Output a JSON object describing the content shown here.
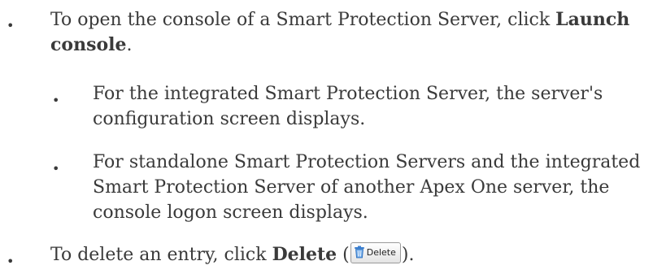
{
  "bullet_glyph": "•",
  "item1": {
    "text_before": "To open the console of a Smart Protection Server, click ",
    "bold": "Launch console",
    "text_after": "."
  },
  "sub1": {
    "text": "For the integrated Smart Protection Server, the server's configuration screen displays."
  },
  "sub2": {
    "text": "For standalone Smart Protection Servers and the integrated Smart Protection Server of another Apex One server, the console logon screen displays."
  },
  "item2": {
    "text_before": "To delete an entry, click ",
    "bold": "Delete",
    "text_mid": " (",
    "button_label": "Delete",
    "button_icon": "trash-icon",
    "text_after": ")."
  }
}
